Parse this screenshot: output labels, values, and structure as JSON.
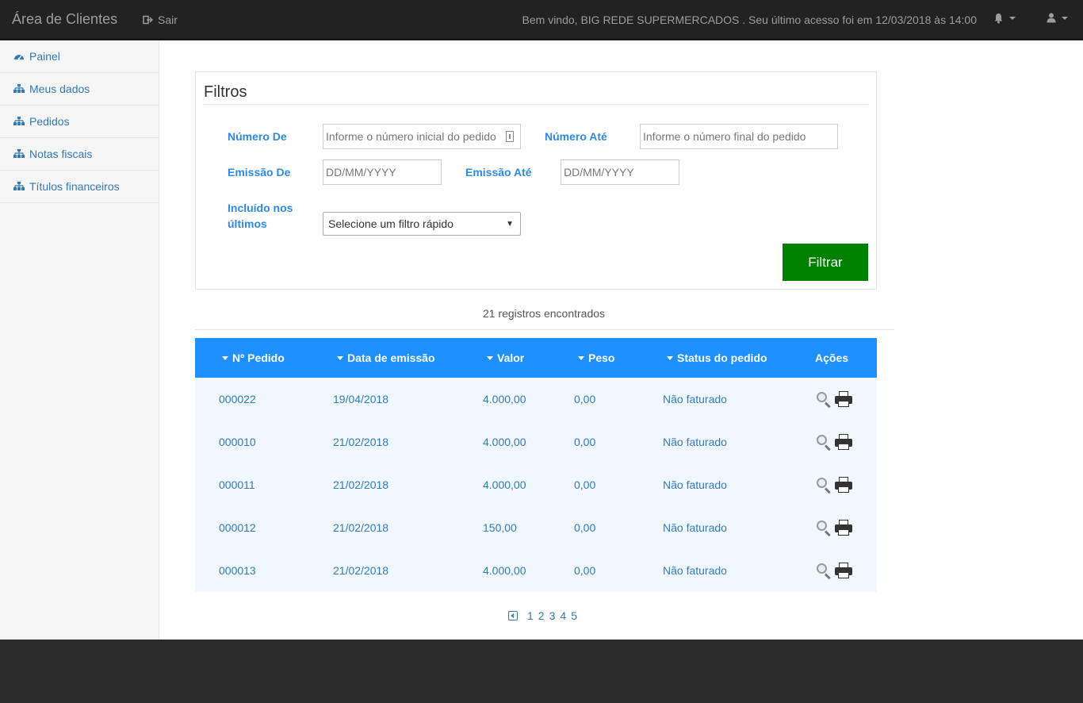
{
  "navbar": {
    "brand": "Área de Clientes",
    "logout_label": "Sair",
    "welcome": "Bem vindo, BIG REDE SUPERMERCADOS . Seu último acesso foi em 12/03/2018 às 14:00"
  },
  "sidebar": {
    "items": [
      {
        "label": "Painel",
        "icon": "dashboard-icon"
      },
      {
        "label": "Meus dados",
        "icon": "sitemap-icon"
      },
      {
        "label": "Pedidos",
        "icon": "sitemap-icon"
      },
      {
        "label": "Notas fiscais",
        "icon": "sitemap-icon"
      },
      {
        "label": "Títulos financeiros",
        "icon": "sitemap-icon"
      }
    ]
  },
  "filters": {
    "title": "Filtros",
    "numero_de_label": "Número De",
    "numero_de_placeholder": "Informe o número inicial do pedido",
    "numero_ate_label": "Número Até",
    "numero_ate_placeholder": "Informe o número final do pedido",
    "emissao_de_label": "Emissão De",
    "emissao_de_placeholder": "DD/MM/YYYY",
    "emissao_ate_label": "Emissão Até",
    "emissao_ate_placeholder": "DD/MM/YYYY",
    "incluido_label_1": "Incluído nos",
    "incluido_label_2": "últimos",
    "quick_filter_value": "Selecione um filtro rápido",
    "filter_button": "Filtrar"
  },
  "records_text": "21 registros encontrados",
  "table": {
    "headers": {
      "pedido": "Nº Pedido",
      "emissao": "Data de emissão",
      "valor": "Valor",
      "peso": "Peso",
      "status": "Status do pedido",
      "acoes": "Ações"
    },
    "rows": [
      {
        "pedido": "000022",
        "emissao": "19/04/2018",
        "valor": "4.000,00",
        "peso": "0,00",
        "status": "Não faturado"
      },
      {
        "pedido": "000010",
        "emissao": "21/02/2018",
        "valor": "4.000,00",
        "peso": "0,00",
        "status": "Não faturado"
      },
      {
        "pedido": "000011",
        "emissao": "21/02/2018",
        "valor": "4.000,00",
        "peso": "0,00",
        "status": "Não faturado"
      },
      {
        "pedido": "000012",
        "emissao": "21/02/2018",
        "valor": "150,00",
        "peso": "0,00",
        "status": "Não faturado"
      },
      {
        "pedido": "000013",
        "emissao": "21/02/2018",
        "valor": "4.000,00",
        "peso": "0,00",
        "status": "Não faturado"
      }
    ]
  },
  "pagination": {
    "pages": [
      "1",
      "2",
      "3",
      "4",
      "5"
    ]
  },
  "colors": {
    "accent": "#1e90ff",
    "filter_button": "#008000",
    "navbar": "#222222"
  }
}
